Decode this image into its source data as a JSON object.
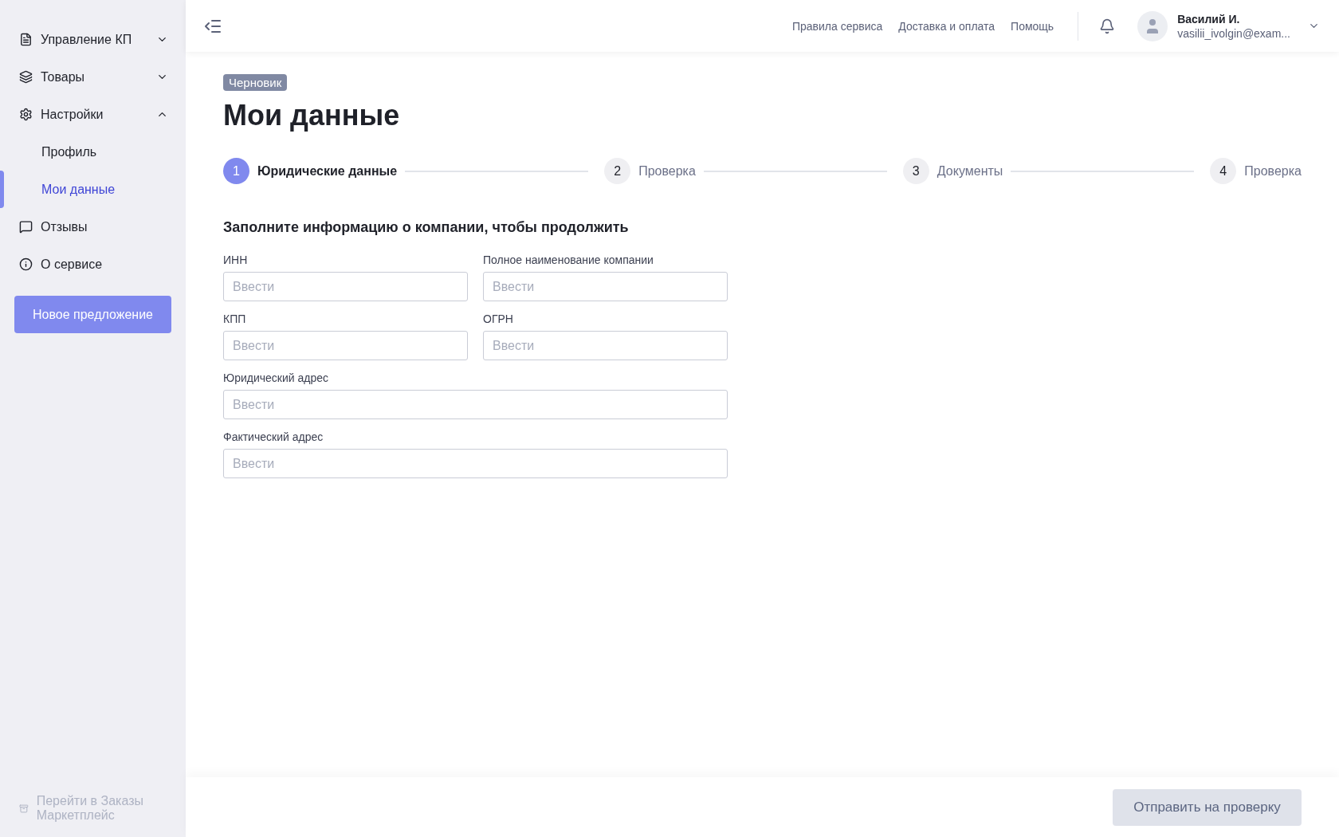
{
  "sidebar": {
    "items": [
      {
        "label": "Управление КП",
        "expanded": false,
        "selected": false
      },
      {
        "label": "Товары",
        "expanded": false,
        "selected": false
      },
      {
        "label": "Настройки",
        "expanded": true,
        "selected": false,
        "children": [
          {
            "label": "Профиль",
            "selected": false
          },
          {
            "label": "Мои данные",
            "selected": true
          }
        ]
      },
      {
        "label": "Отзывы",
        "selected": false
      },
      {
        "label": "О сервисе",
        "selected": false
      }
    ],
    "new_button": "Новое предложение",
    "footer_link": {
      "label": "Перейти в Заказы Маркетплейс",
      "disabled": true
    }
  },
  "header": {
    "links": [
      "Правила сервиса",
      "Доставка и оплата",
      "Помощь"
    ],
    "user": {
      "name": "Василий И.",
      "email": "vasilii_ivolgin@exam..."
    }
  },
  "page": {
    "badge": "Черновик",
    "title": "Мои данные",
    "steps": [
      {
        "number": "1",
        "label": "Юридические данные",
        "selected": true
      },
      {
        "number": "2",
        "label": "Проверка",
        "selected": false
      },
      {
        "number": "3",
        "label": "Документы",
        "selected": false
      },
      {
        "number": "4",
        "label": "Проверка",
        "selected": false
      }
    ],
    "form_title": "Заполните информацию о компании, чтобы продолжить",
    "fields": [
      {
        "label": "ИНН",
        "placeholder": "Ввести"
      },
      {
        "label": "Полное наименование компании",
        "placeholder": "Ввести"
      },
      {
        "label": "КПП",
        "placeholder": "Ввести"
      },
      {
        "label": "ОГРН",
        "placeholder": "Ввести"
      },
      {
        "label": "Юридический адрес",
        "placeholder": "Ввести"
      },
      {
        "label": "Фактический адрес",
        "placeholder": "Ввести"
      }
    ]
  },
  "footer": {
    "submit": "Отправить на проверку"
  }
}
